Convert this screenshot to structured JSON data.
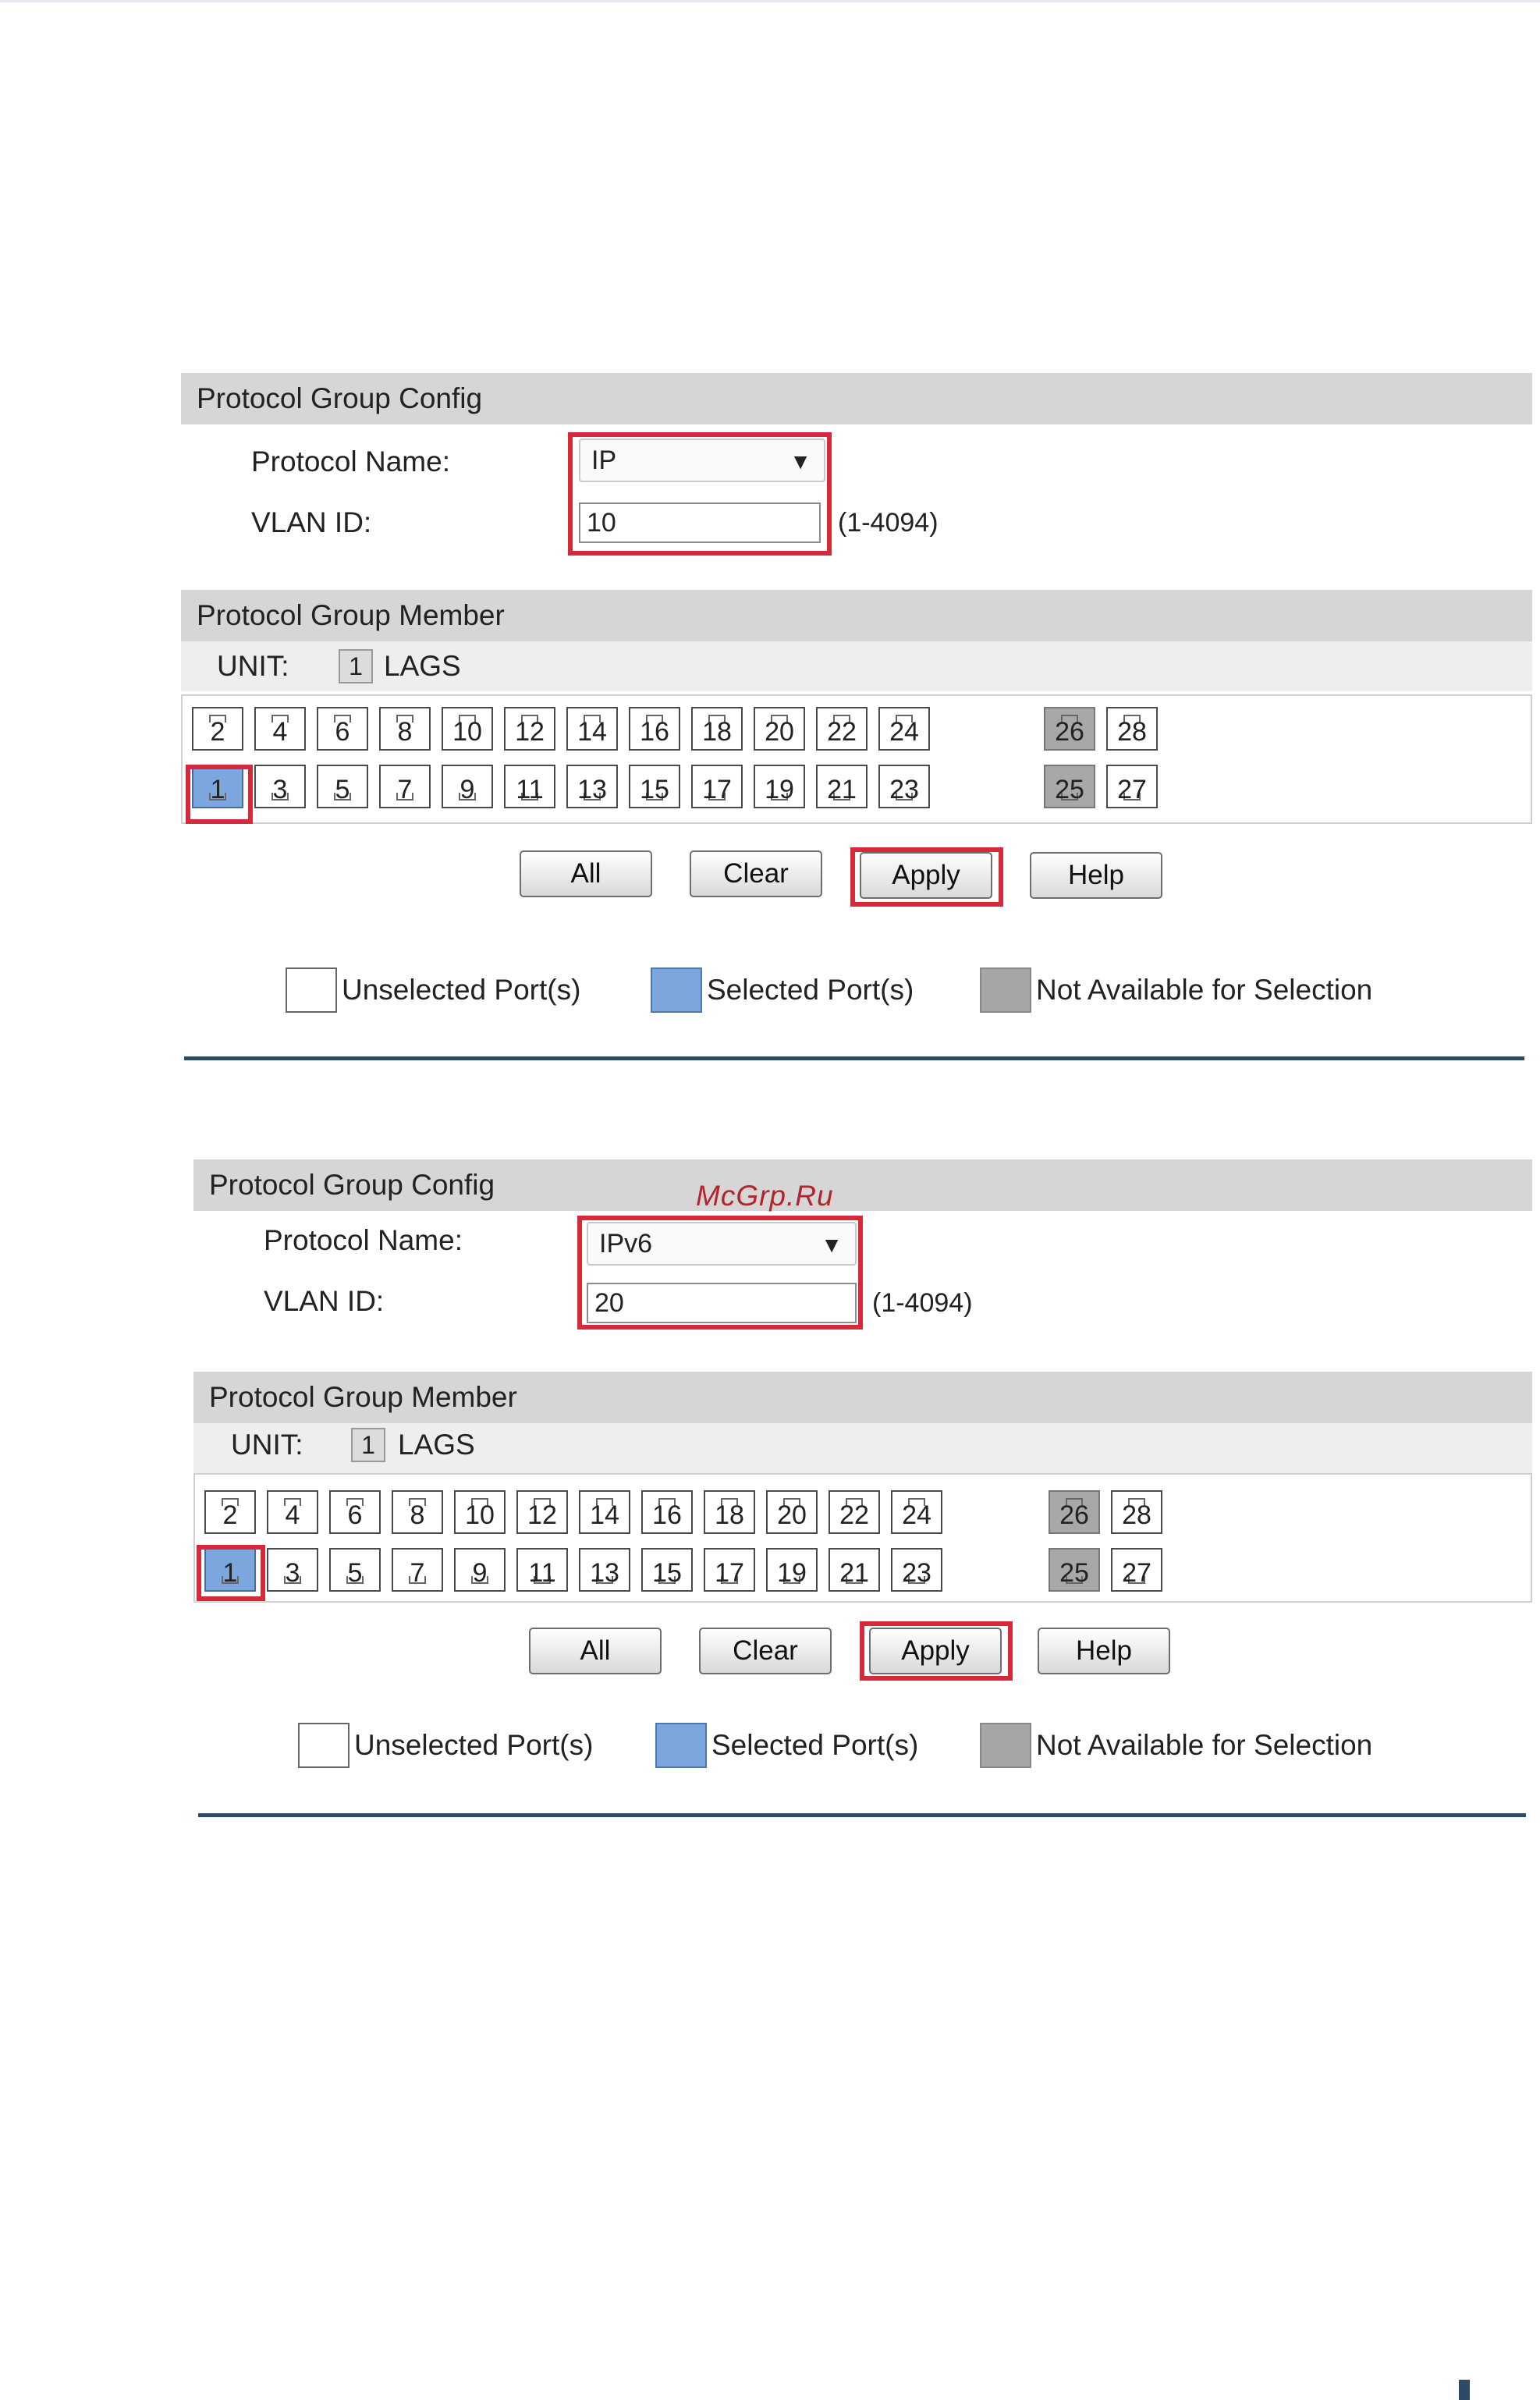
{
  "panels": [
    {
      "config_header": "Protocol Group Config",
      "protocol_name_label": "Protocol Name:",
      "protocol_name_value": "IP",
      "vlan_id_label": "VLAN ID:",
      "vlan_id_value": "10",
      "vlan_range": "(1-4094)",
      "member_header": "Protocol Group Member",
      "unit_label": "UNIT:",
      "unit_value": "1",
      "lags_label": "LAGS",
      "ports_top": [
        "2",
        "4",
        "6",
        "8",
        "10",
        "12",
        "14",
        "16",
        "18",
        "20",
        "22",
        "24"
      ],
      "ports_bottom": [
        "1",
        "3",
        "5",
        "7",
        "9",
        "11",
        "13",
        "15",
        "17",
        "19",
        "21",
        "23"
      ],
      "sfp_top": [
        "26",
        "28"
      ],
      "sfp_bottom": [
        "25",
        "27"
      ],
      "selected_ports": [
        "1"
      ],
      "unavailable_ports": [
        "25",
        "26"
      ],
      "buttons": {
        "all": "All",
        "clear": "Clear",
        "apply": "Apply",
        "help": "Help"
      },
      "legend": {
        "unselected": "Unselected Port(s)",
        "selected": "Selected Port(s)",
        "na": "Not Available for Selection"
      }
    },
    {
      "config_header": "Protocol Group Config",
      "protocol_name_label": "Protocol Name:",
      "protocol_name_value": "IPv6",
      "vlan_id_label": "VLAN ID:",
      "vlan_id_value": "20",
      "vlan_range": "(1-4094)",
      "member_header": "Protocol Group Member",
      "unit_label": "UNIT:",
      "unit_value": "1",
      "lags_label": "LAGS",
      "ports_top": [
        "2",
        "4",
        "6",
        "8",
        "10",
        "12",
        "14",
        "16",
        "18",
        "20",
        "22",
        "24"
      ],
      "ports_bottom": [
        "1",
        "3",
        "5",
        "7",
        "9",
        "11",
        "13",
        "15",
        "17",
        "19",
        "21",
        "23"
      ],
      "sfp_top": [
        "26",
        "28"
      ],
      "sfp_bottom": [
        "25",
        "27"
      ],
      "selected_ports": [
        "1"
      ],
      "unavailable_ports": [
        "25",
        "26"
      ],
      "buttons": {
        "all": "All",
        "clear": "Clear",
        "apply": "Apply",
        "help": "Help"
      },
      "legend": {
        "unselected": "Unselected Port(s)",
        "selected": "Selected Port(s)",
        "na": "Not Available for Selection"
      }
    }
  ],
  "watermark": "McGrp.Ru",
  "icons": {
    "dropdown": "chevron-down-icon",
    "port": "ethernet-port-icon"
  }
}
